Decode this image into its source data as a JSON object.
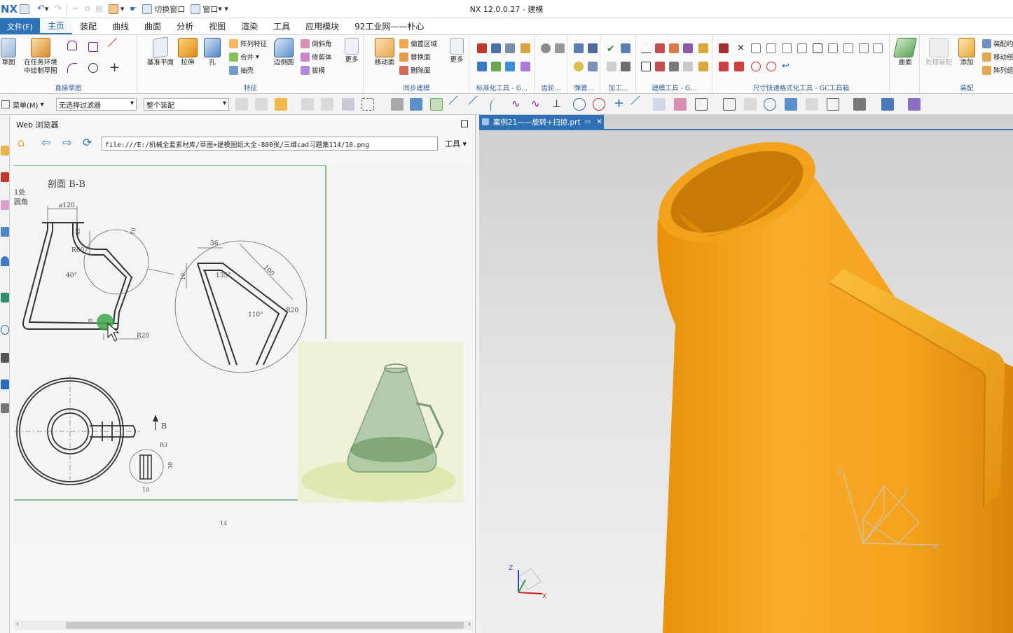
{
  "titlebar": {
    "app_title": "NX 12.0.0.27 - 建模",
    "switch_window": "切换窗口",
    "window_menu": "窗口"
  },
  "menu": {
    "file": "文件(F)",
    "tabs": [
      "主页",
      "装配",
      "曲线",
      "曲面",
      "分析",
      "视图",
      "渲染",
      "工具",
      "应用模块",
      "92工业网——朴心"
    ]
  },
  "ribbon": {
    "sketch": "草图",
    "sketch_in_task_1": "在任务环境",
    "sketch_in_task_2": "中绘制草图",
    "direct_sketch_label": "直接草图",
    "datum_plane": "基准平面",
    "extrude": "拉伸",
    "hole": "孔",
    "pattern_feature": "阵列特征",
    "unite": "合并",
    "shell": "抽壳",
    "edge_blend": "边倒圆",
    "chamfer": "倒斜角",
    "trim_body": "修剪体",
    "draft": "拔模",
    "more_feature": "更多",
    "feature_label": "特征",
    "move_face": "移动面",
    "offset_region": "偏置区域",
    "replace_face": "替换面",
    "delete_face": "删除面",
    "more_sync": "更多",
    "sync_label": "同步建模",
    "std_tools": "标准化工具 - G...",
    "gear": "齿轮...",
    "spring": "弹簧...",
    "machining": "加工...",
    "modeling_tools": "建模工具 - G...",
    "dim_tools": "尺寸快速格式化工具 - GC工具箱",
    "surface": "曲面",
    "process_assembly": "处理装配",
    "add": "添加",
    "assembly_constraint": "装配约",
    "move_component": "移动组",
    "pattern_component": "阵列组",
    "assembly_label": "装配"
  },
  "toolbar2": {
    "menu": "菜单(M)",
    "filter": "无选择过滤器",
    "scope": "整个装配"
  },
  "web": {
    "title": "Web 浏览器",
    "url": "file:///E:/机械全套素材库/草图+建模图纸大全-800张/三维cad习题集114/10.png",
    "tools": "工具"
  },
  "drawing": {
    "section": "剖面 B-B",
    "note1": "1处",
    "note2": "圆角",
    "d_top": "⌀120",
    "d45": "45",
    "r60": "R60",
    "a40": "40°",
    "d70": "70",
    "d8": "8",
    "r20a": "R20",
    "d36": "36",
    "d10": "10",
    "a135": "135°",
    "d100": "100",
    "a110": "110°",
    "r20b": "R20",
    "b_mark": "B",
    "r3": "R3",
    "d30": "30",
    "d10b": "10",
    "page_no": "14"
  },
  "viewport": {
    "tab_title": "案例21——旋转+扫掠.prt"
  },
  "colors": {
    "model": "#f5a623",
    "accent": "#2e73b8"
  }
}
